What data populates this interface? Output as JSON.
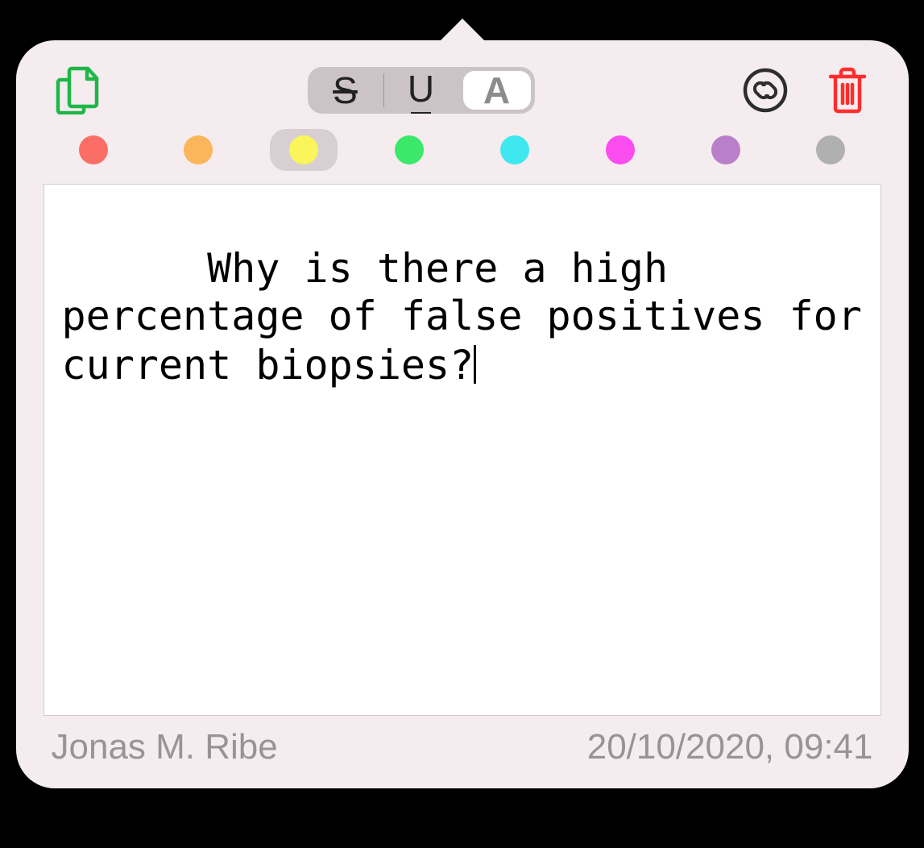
{
  "toolbar": {
    "copy_icon": "copy-icon",
    "link_icon": "link-icon",
    "trash_icon": "trash-icon",
    "segmented": {
      "strike": "S",
      "underline": "U",
      "highlight": "A",
      "selected_index": 2
    }
  },
  "colors": {
    "options": [
      {
        "name": "red",
        "hex": "#fa6e66"
      },
      {
        "name": "orange",
        "hex": "#fbb55a"
      },
      {
        "name": "yellow",
        "hex": "#f9f55a"
      },
      {
        "name": "green",
        "hex": "#3be869"
      },
      {
        "name": "cyan",
        "hex": "#3ee8ee"
      },
      {
        "name": "magenta",
        "hex": "#fb4cf0"
      },
      {
        "name": "purple",
        "hex": "#b980c9"
      },
      {
        "name": "grey",
        "hex": "#b0b0b0"
      }
    ],
    "selected_index": 2
  },
  "note": {
    "text": "Why is there a high percentage of false positives for current biopsies?"
  },
  "footer": {
    "author": "Jonas M. Ribe",
    "timestamp": "20/10/2020, 09:41"
  }
}
